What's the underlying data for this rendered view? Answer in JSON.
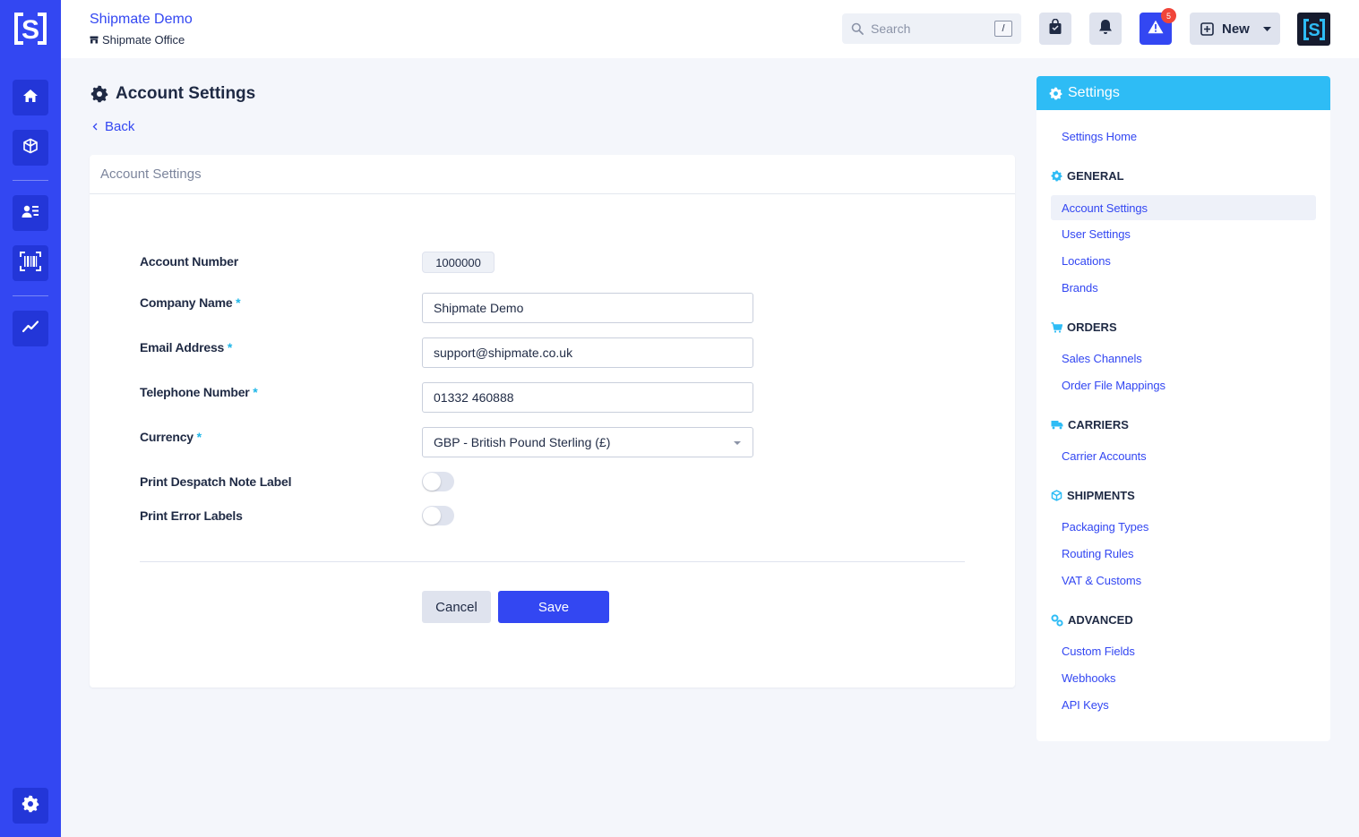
{
  "topbar": {
    "org_name": "Shipmate Demo",
    "location": "Shipmate Office",
    "search_placeholder": "Search",
    "search_shortcut": "/",
    "alerts_count": "5",
    "new_label": "New"
  },
  "page": {
    "title": "Account Settings",
    "back_label": "Back"
  },
  "form": {
    "card_title": "Account Settings",
    "account_number_label": "Account Number",
    "account_number_value": "1000000",
    "company_name_label": "Company Name",
    "company_name_value": "Shipmate Demo",
    "email_label": "Email Address",
    "email_value": "support@shipmate.co.uk",
    "telephone_label": "Telephone Number",
    "telephone_value": "01332 460888",
    "currency_label": "Currency",
    "currency_value": "GBP - British Pound Sterling (£)",
    "print_despatch_label": "Print Despatch Note Label",
    "print_despatch_on": false,
    "print_error_label": "Print Error Labels",
    "print_error_on": false,
    "required_mark": "*",
    "cancel_label": "Cancel",
    "save_label": "Save"
  },
  "sidebar": {
    "title": "Settings",
    "home_label": "Settings Home",
    "sections": [
      {
        "title": "GENERAL",
        "icon": "gear-icon",
        "items": [
          "Account Settings",
          "User Settings",
          "Locations",
          "Brands"
        ]
      },
      {
        "title": "ORDERS",
        "icon": "cart-icon",
        "items": [
          "Sales Channels",
          "Order File Mappings"
        ]
      },
      {
        "title": "CARRIERS",
        "icon": "truck-icon",
        "items": [
          "Carrier Accounts"
        ]
      },
      {
        "title": "SHIPMENTS",
        "icon": "box-icon",
        "items": [
          "Packaging Types",
          "Routing Rules",
          "VAT & Customs"
        ]
      },
      {
        "title": "ADVANCED",
        "icon": "cogs-icon",
        "items": [
          "Custom Fields",
          "Webhooks",
          "API Keys"
        ]
      }
    ],
    "active_item": "Account Settings"
  },
  "rail": {
    "items": [
      "home-icon",
      "box-icon",
      "contacts-icon",
      "barcode-icon",
      "chart-icon",
      "gear-icon"
    ]
  },
  "colors": {
    "brand": "#3347f2",
    "accent": "#2ebcf5",
    "alert": "#f0453a"
  }
}
